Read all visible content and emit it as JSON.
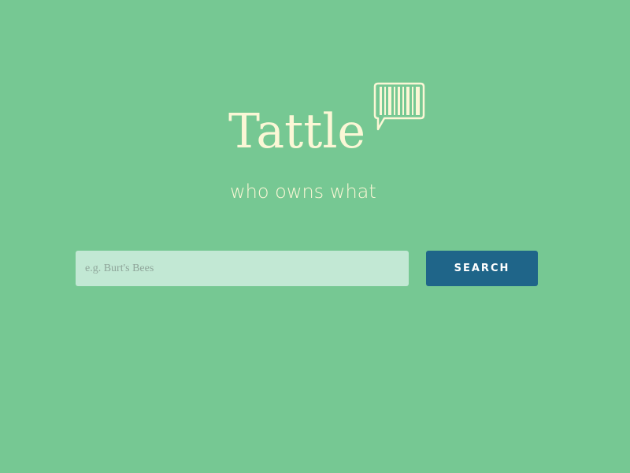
{
  "brand": {
    "name": "Tattle",
    "tagline": "who owns what",
    "logo_icon": "barcode-speech-bubble-icon"
  },
  "search": {
    "placeholder": "e.g. Burt's Bees",
    "value": "",
    "button_label": "SEARCH"
  },
  "colors": {
    "background": "#76c893",
    "logo_text": "#fbf7d6",
    "input_background": "#c2e8d4",
    "button_background": "#1f6589",
    "button_text": "#ffffff"
  }
}
